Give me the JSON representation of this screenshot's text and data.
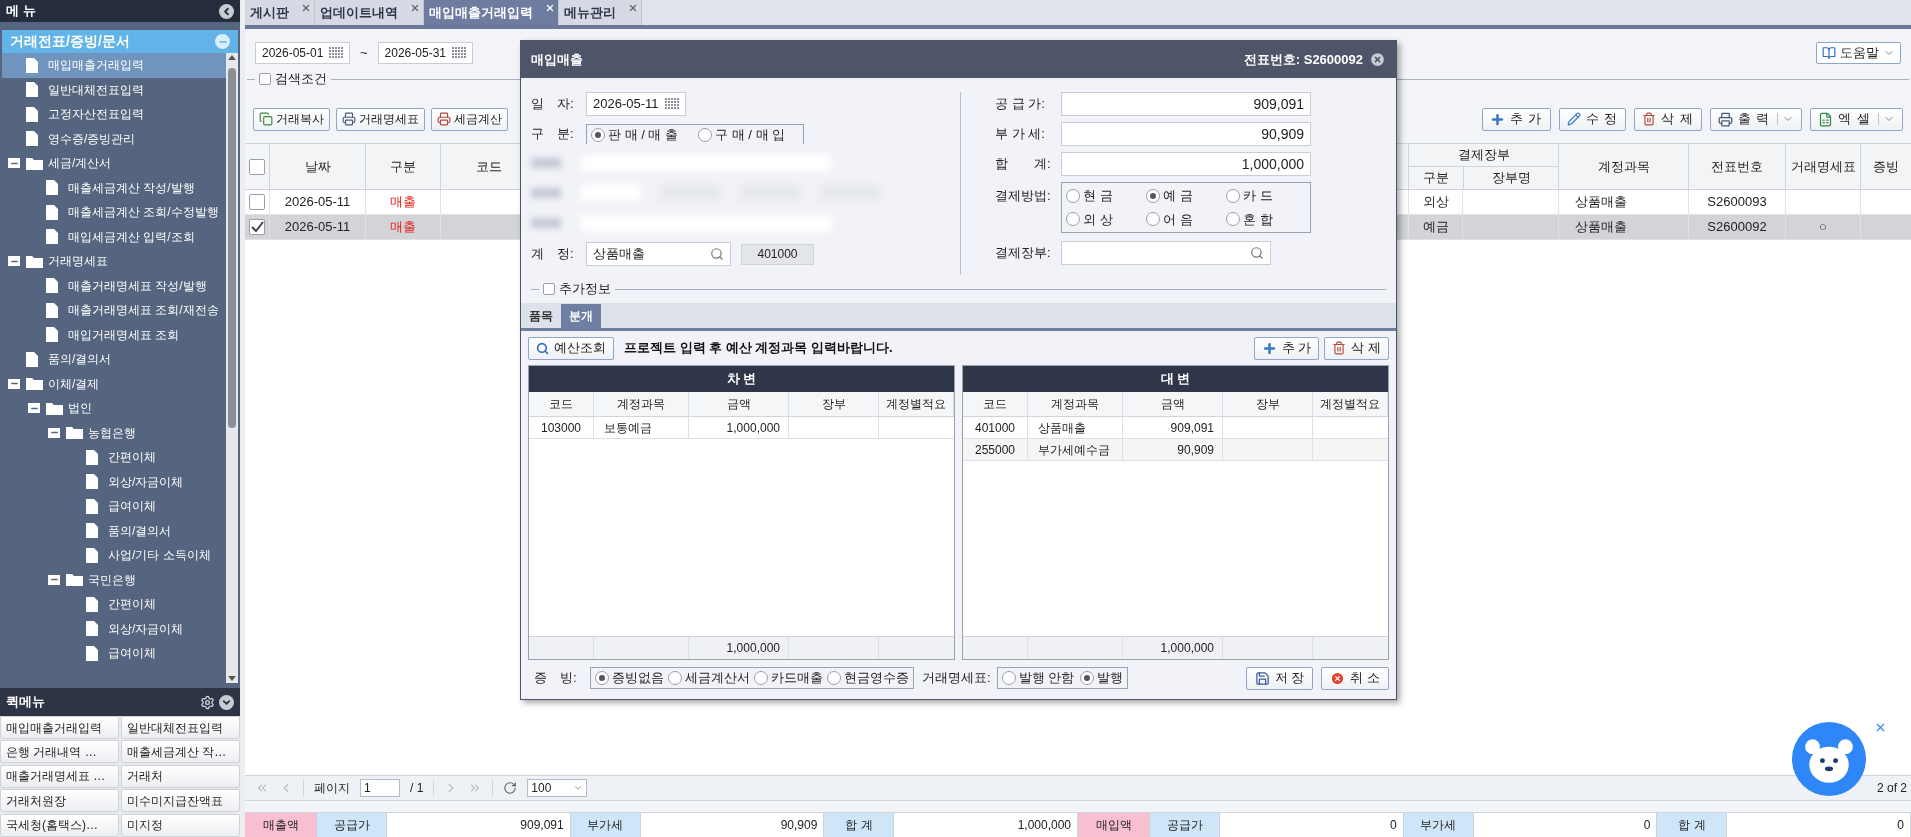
{
  "sidebar": {
    "title": "메 뉴",
    "section": "거래전표/증빙/문서",
    "tree": [
      {
        "label": "매입매출거래입력",
        "kind": "file",
        "selected": true
      },
      {
        "label": "일반대체전표입력",
        "kind": "file",
        "selected": false
      },
      {
        "label": "고정자산전표입력",
        "kind": "file",
        "selected": false
      },
      {
        "label": "영수증/증빙관리",
        "kind": "file",
        "selected": false
      },
      {
        "label": "세금/계산서",
        "kind": "folder",
        "selected": false,
        "expanded": true,
        "children": [
          {
            "label": "매출세금계산 작성/발행",
            "kind": "file",
            "selected": false
          },
          {
            "label": "매출세금계산 조회/수정발행",
            "kind": "file",
            "selected": false
          },
          {
            "label": "매입세금계산 입력/조회",
            "kind": "file",
            "selected": false
          }
        ]
      },
      {
        "label": "거래명세표",
        "kind": "folder",
        "selected": false,
        "expanded": true,
        "children": [
          {
            "label": "매출거래명세표 작성/발행",
            "kind": "file",
            "selected": false
          },
          {
            "label": "매출거래명세표 조회/재전송",
            "kind": "file",
            "selected": false
          },
          {
            "label": "매입거래명세표 조회",
            "kind": "file",
            "selected": false
          }
        ]
      },
      {
        "label": "품의/결의서",
        "kind": "file",
        "selected": false
      },
      {
        "label": "이체/결제",
        "kind": "folder",
        "selected": false,
        "expanded": true,
        "children": [
          {
            "label": "법인",
            "kind": "folder",
            "selected": false,
            "expanded": true,
            "children": [
              {
                "label": "농협은행",
                "kind": "folder",
                "selected": false,
                "expanded": true,
                "children": [
                  {
                    "label": "간편이체",
                    "kind": "file",
                    "selected": false
                  },
                  {
                    "label": "외상/자금이체",
                    "kind": "file",
                    "selected": false
                  },
                  {
                    "label": "급여이체",
                    "kind": "file",
                    "selected": false
                  },
                  {
                    "label": "품의/결의서",
                    "kind": "file",
                    "selected": false
                  },
                  {
                    "label": "사업/기타 소득이체",
                    "kind": "file",
                    "selected": false
                  }
                ]
              },
              {
                "label": "국민은행",
                "kind": "folder",
                "selected": false,
                "expanded": true,
                "children": [
                  {
                    "label": "간편이체",
                    "kind": "file",
                    "selected": false
                  },
                  {
                    "label": "외상/자금이체",
                    "kind": "file",
                    "selected": false
                  },
                  {
                    "label": "급여이체",
                    "kind": "file",
                    "selected": false
                  }
                ]
              }
            ]
          }
        ]
      }
    ]
  },
  "quick_menu": {
    "title": "퀵메뉴",
    "items": [
      "매입매출거래입력",
      "일반대체전표입력",
      "은행 거래내역 …",
      "매출세금계산 작…",
      "매출거래명세표 …",
      "거래처",
      "거래처원장",
      "미수미지급잔액표",
      "국세청(홈택스)…",
      "미지정"
    ]
  },
  "tabs": [
    {
      "label": "게시판",
      "selected": false
    },
    {
      "label": "업데이트내역",
      "selected": false
    },
    {
      "label": "매입매출거래입력",
      "selected": true
    },
    {
      "label": "메뉴관리",
      "selected": false
    }
  ],
  "filter": {
    "date_from": "2026-05-01",
    "separator": "~",
    "date_to": "2026-05-31",
    "search_toggle": {
      "label": "검색조건",
      "checked": false
    },
    "help": "도움말"
  },
  "toolbar_left": [
    "거래복사",
    "거래명세표",
    "세금계산"
  ],
  "toolbar_right": [
    {
      "label": "추 가",
      "kind": "add",
      "dropdown": false
    },
    {
      "label": "수 정",
      "kind": "edit",
      "dropdown": false
    },
    {
      "label": "삭 제",
      "kind": "delete",
      "dropdown": false
    },
    {
      "label": "출 력",
      "kind": "print",
      "dropdown": true
    },
    {
      "label": "엑 셀",
      "kind": "excel",
      "dropdown": true
    }
  ],
  "table": {
    "select_all": {
      "checked": false
    },
    "columns": {
      "date": "날짜",
      "type": "구분",
      "code": "코드",
      "ledger": "결제장부",
      "ledger_type": "구분",
      "ledger_name": "장부명",
      "account": "계정과목",
      "voucher": "전표번호",
      "statement": "거래명세표",
      "evidence": "증빙"
    },
    "rows": [
      {
        "checked": false,
        "date": "2026-05-11",
        "type": "매출",
        "ledger_type": "외상",
        "account": "상품매출",
        "voucher": "S2600093"
      },
      {
        "checked": true,
        "date": "2026-05-11",
        "type": "매출",
        "ledger_type": "예금",
        "account": "상품매출",
        "voucher": "S2600092",
        "statement": "○"
      }
    ]
  },
  "modal": {
    "title": "매입매출",
    "voucher": "전표번호: S2600092",
    "date": {
      "label": "일　자:",
      "value": "2026-05-11"
    },
    "division": {
      "label": "구　분:",
      "options": [
        {
          "label": "판 매 / 매 출",
          "selected": true
        },
        {
          "label": "구 매 / 매 입",
          "selected": false
        }
      ]
    },
    "account": {
      "label": "계　정:",
      "value": "상품매출",
      "code": "401000"
    },
    "amounts": [
      {
        "label": "공 급 가:",
        "value": "909,091"
      },
      {
        "label": "부 가 세:",
        "value": "90,909"
      },
      {
        "label": "합　　계:",
        "value": "1,000,000"
      }
    ],
    "payment": {
      "label": "결제방법:",
      "options": [
        {
          "label": "현 금",
          "selected": false
        },
        {
          "label": "예 금",
          "selected": true
        },
        {
          "label": "카 드",
          "selected": false
        },
        {
          "label": "외 상",
          "selected": false
        },
        {
          "label": "어 음",
          "selected": false
        },
        {
          "label": "혼 합",
          "selected": false
        }
      ]
    },
    "ledger": {
      "label": "결제장부:"
    },
    "extra": {
      "label": "추가정보",
      "checked": false
    },
    "sub_tabs": [
      {
        "label": "품목",
        "selected": false
      },
      {
        "label": "분개",
        "selected": true
      }
    ],
    "budget_button": "예산조회",
    "notice": "프로젝트 입력 후 예산 계정과목 입력바랍니다.",
    "actions": [
      {
        "label": "추 가",
        "kind": "add"
      },
      {
        "label": "삭 제",
        "kind": "delete"
      }
    ],
    "journals": [
      {
        "title": "차 변",
        "columns": [
          "코드",
          "계정과목",
          "금액",
          "장부",
          "계정별적요"
        ],
        "rows": [
          {
            "code": "103000",
            "account": "보통예금",
            "amount": "1,000,000"
          }
        ],
        "total": "1,000,000"
      },
      {
        "title": "대 변",
        "columns": [
          "코드",
          "계정과목",
          "금액",
          "장부",
          "계정별적요"
        ],
        "rows": [
          {
            "code": "401000",
            "account": "상품매출",
            "amount": "909,091"
          },
          {
            "code": "255000",
            "account": "부가세예수금",
            "amount": "90,909"
          }
        ],
        "total": "1,000,000"
      }
    ],
    "evidence": {
      "label": "증　빙:",
      "options": [
        {
          "label": "증빙없음",
          "selected": true
        },
        {
          "label": "세금계산서",
          "selected": false
        },
        {
          "label": "카드매출",
          "selected": false
        },
        {
          "label": "현금영수증",
          "selected": false
        }
      ]
    },
    "statement": {
      "label": "거래명세표:",
      "options": [
        {
          "label": "발행 안함",
          "selected": false
        },
        {
          "label": "발행",
          "selected": true
        }
      ]
    },
    "buttons": [
      {
        "label": "저 장",
        "kind": "save"
      },
      {
        "label": "취 소",
        "kind": "cancel"
      }
    ]
  },
  "pager": {
    "label": "페이지",
    "page": "1",
    "of": "/ 1",
    "size": "100",
    "count": "2 of 2"
  },
  "summary": [
    {
      "kind": "group",
      "text": "매출액"
    },
    {
      "kind": "label",
      "text": "공급가"
    },
    {
      "kind": "value",
      "text": "909,091"
    },
    {
      "kind": "label",
      "text": "부가세"
    },
    {
      "kind": "value",
      "text": "90,909"
    },
    {
      "kind": "label",
      "text": "합 계"
    },
    {
      "kind": "value",
      "text": "1,000,000"
    },
    {
      "kind": "group",
      "text": "매입액"
    },
    {
      "kind": "label",
      "text": "공급가"
    },
    {
      "kind": "value",
      "text": "0"
    },
    {
      "kind": "label",
      "text": "부가세"
    },
    {
      "kind": "value",
      "text": "0"
    },
    {
      "kind": "label",
      "text": "합 계"
    },
    {
      "kind": "value",
      "text": "0"
    }
  ]
}
